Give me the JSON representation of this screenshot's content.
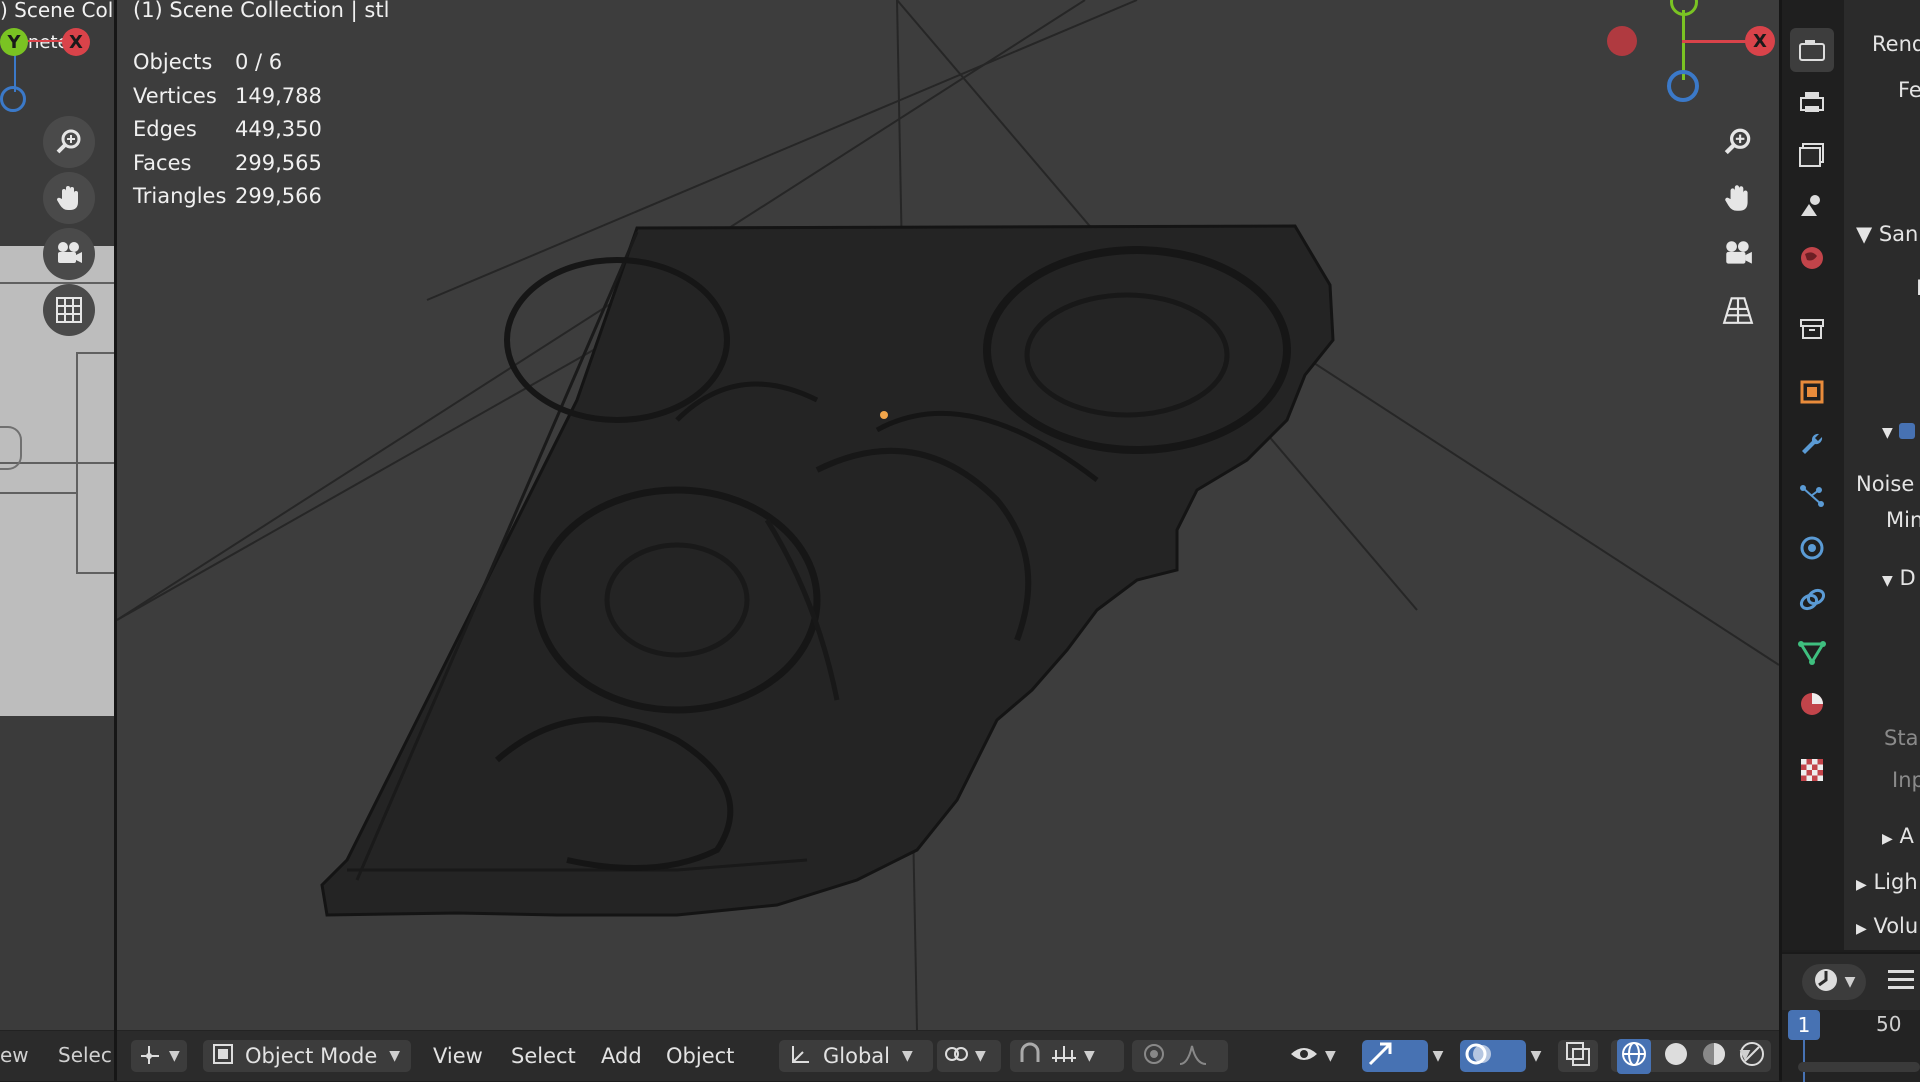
{
  "left_viewport": {
    "title": ") Scene Col",
    "subtitle": "nete",
    "axis_y": "Y",
    "axis_x": "X"
  },
  "left_footer": {
    "view_label": "ew",
    "select_label": "Selec"
  },
  "viewport": {
    "title": "(1) Scene Collection | stl",
    "stats": [
      {
        "label": "Objects",
        "value": "0 / 6"
      },
      {
        "label": "Vertices",
        "value": "149,788"
      },
      {
        "label": "Edges",
        "value": "449,350"
      },
      {
        "label": "Faces",
        "value": "299,565"
      },
      {
        "label": "Triangles",
        "value": "299,566"
      }
    ],
    "gizmo": {
      "x_label": "X"
    }
  },
  "header": {
    "mode": "Object Mode",
    "menus": [
      "View",
      "Select",
      "Add",
      "Object"
    ],
    "orientation": "Global"
  },
  "properties": {
    "lines": [
      "Rend",
      "Fe",
      "San",
      "I",
      "Noise T",
      "Min",
      "D",
      "Star",
      "Inp",
      "A",
      "Ligh",
      "Volu"
    ]
  },
  "timeline": {
    "current_frame": "1",
    "end_frame": "50"
  },
  "colors": {
    "axis_x": "#d9434a",
    "axis_y": "#7ac323",
    "axis_z": "#3b79c8",
    "active_blue": "#4772b3"
  }
}
